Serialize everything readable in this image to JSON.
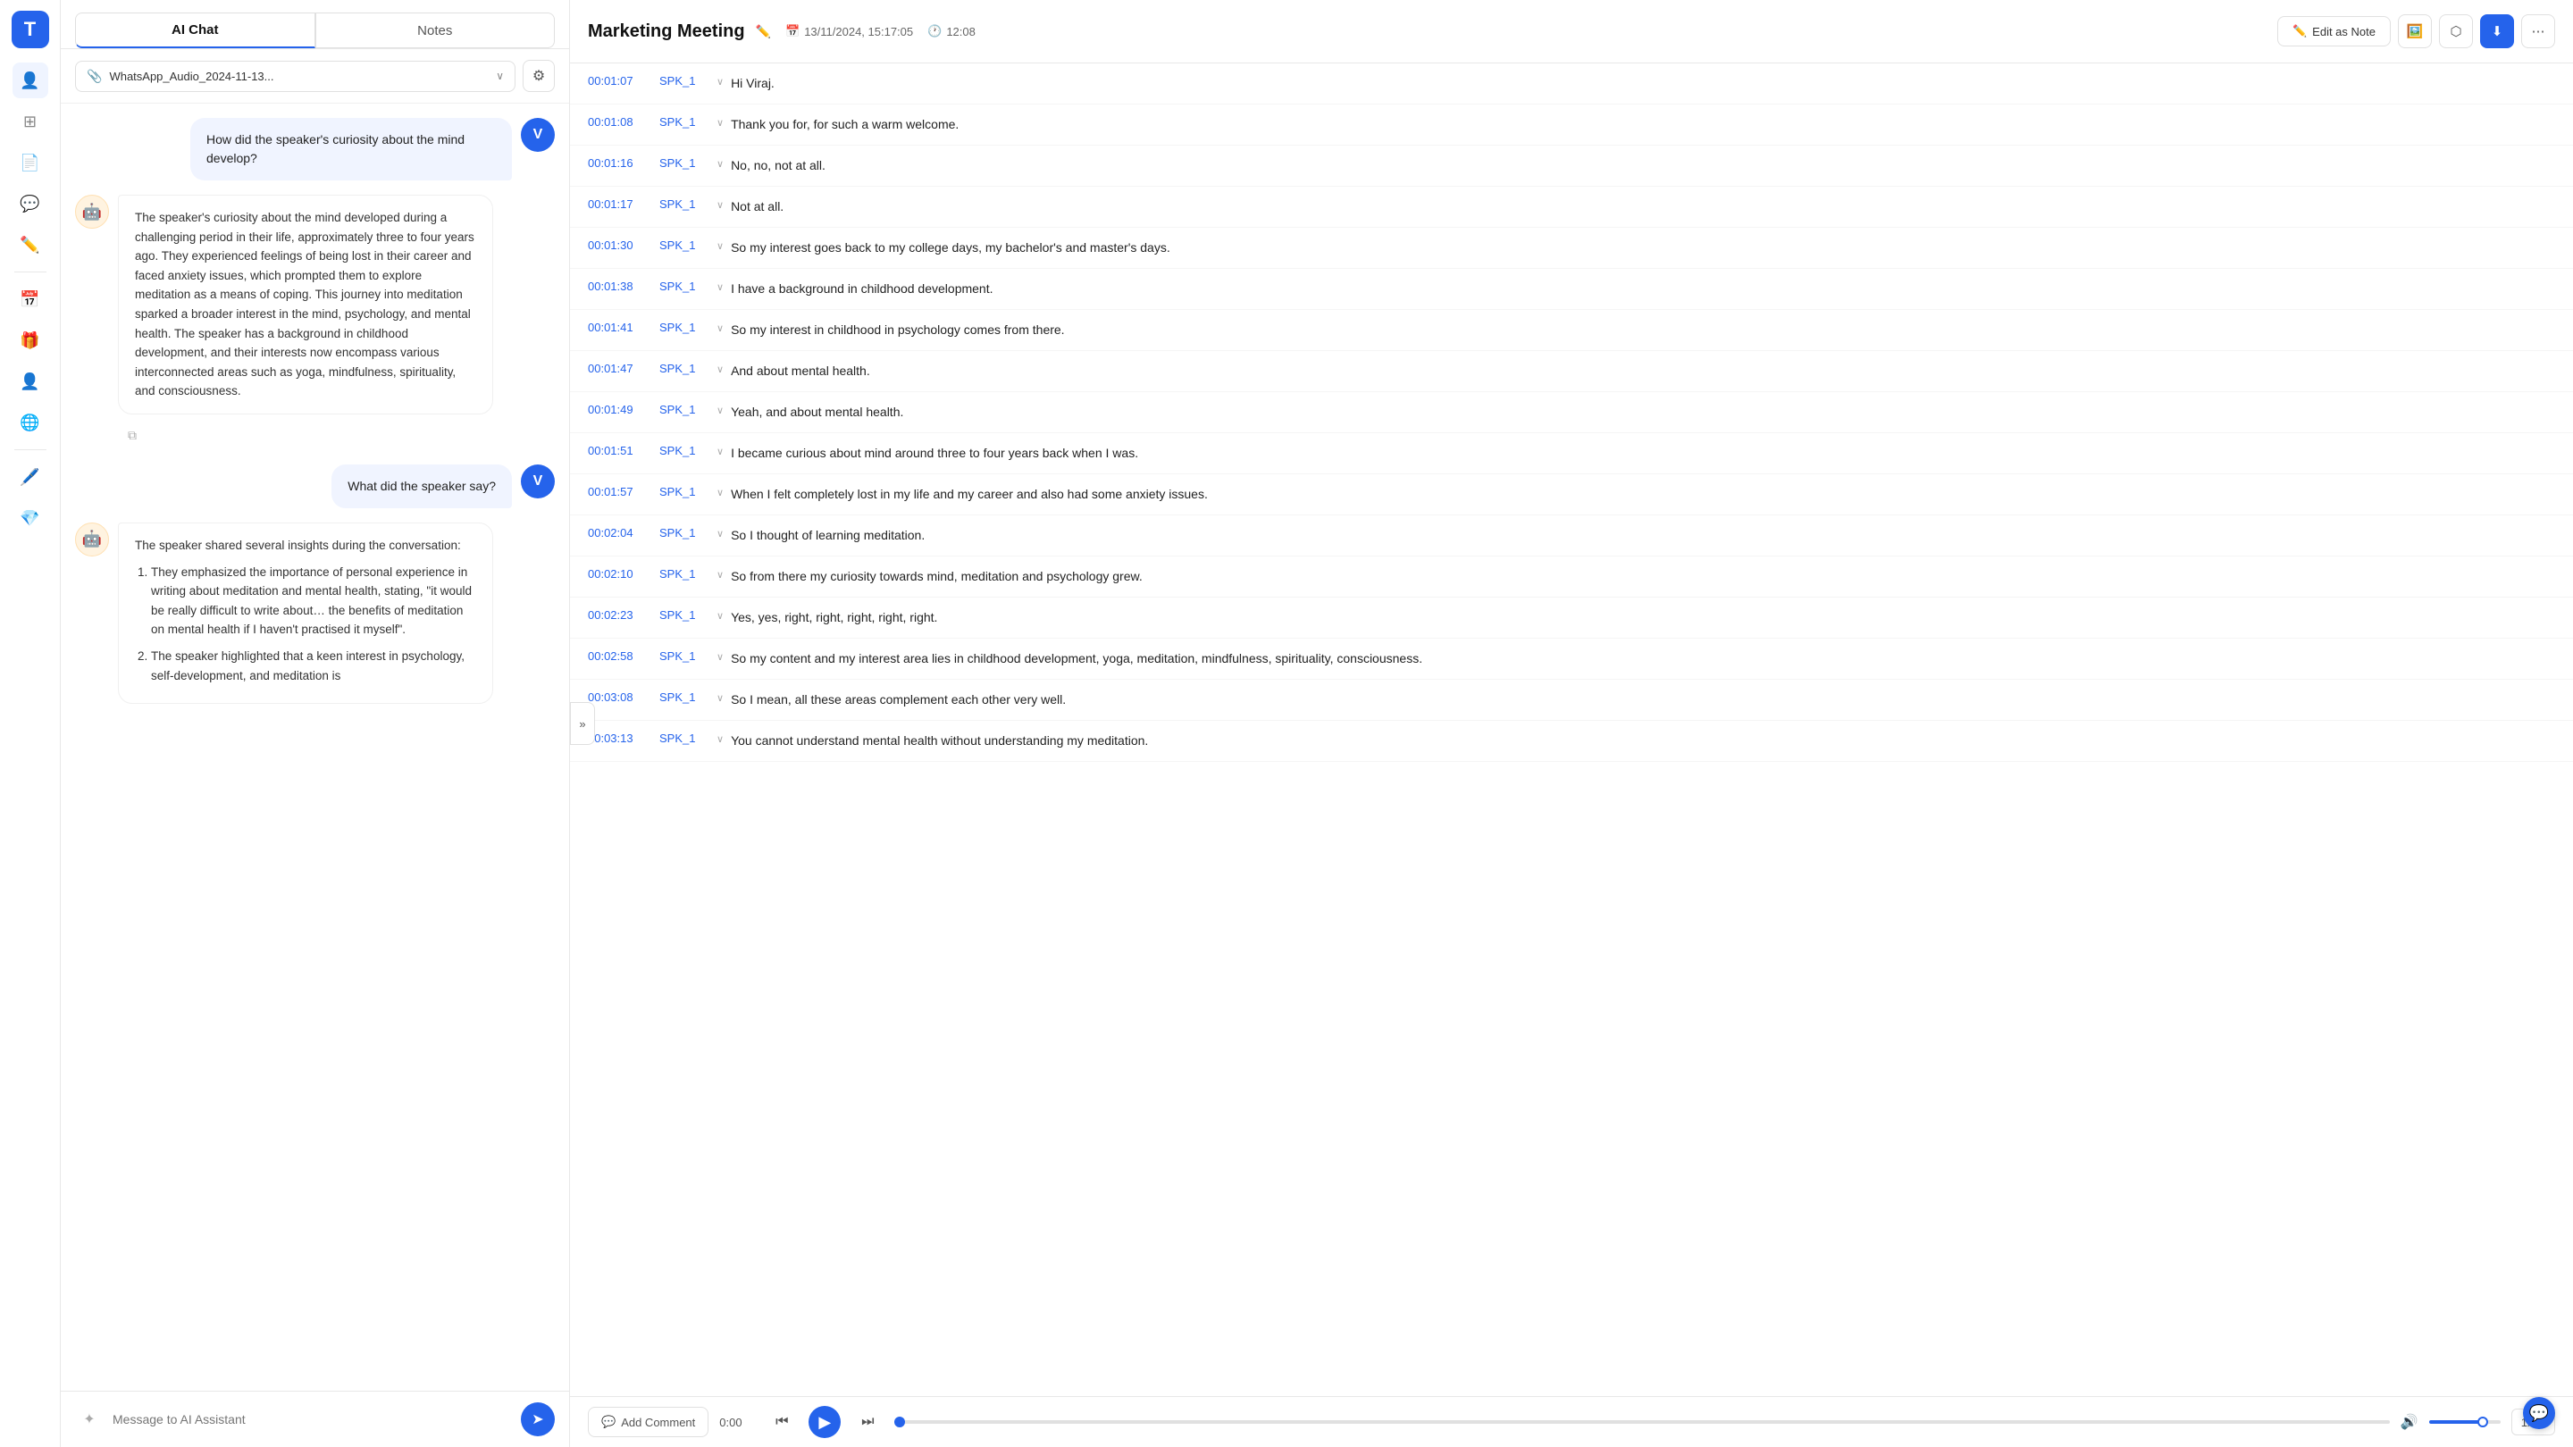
{
  "sidebar": {
    "logo_letter": "T",
    "items": [
      {
        "name": "users",
        "icon": "👤",
        "active": true
      },
      {
        "name": "grid",
        "icon": "⊞",
        "active": false
      },
      {
        "name": "document",
        "icon": "📄",
        "active": false
      },
      {
        "name": "chat",
        "icon": "💬",
        "active": false
      },
      {
        "name": "edit",
        "icon": "✏️",
        "active": false
      },
      {
        "name": "calendar",
        "icon": "📅",
        "active": false
      },
      {
        "name": "gift",
        "icon": "🎁",
        "active": false
      },
      {
        "name": "person",
        "icon": "👤",
        "active": false
      },
      {
        "name": "translate",
        "icon": "🌐",
        "active": false
      },
      {
        "name": "pen",
        "icon": "🖊️",
        "active": false
      },
      {
        "name": "diamond",
        "icon": "💎",
        "active": false
      }
    ]
  },
  "left_panel": {
    "tab_ai_chat": "AI Chat",
    "tab_notes": "Notes",
    "file_name": "WhatsApp_Audio_2024-11-13...",
    "messages": [
      {
        "type": "user",
        "avatar": "V",
        "text": "How did the speaker's curiosity about the mind develop?"
      },
      {
        "type": "ai",
        "text": "The speaker's curiosity about the mind developed during a challenging period in their life, approximately three to four years ago. They experienced feelings of being lost in their career and faced anxiety issues, which prompted them to explore meditation as a means of coping. This journey into meditation sparked a broader interest in the mind, psychology, and mental health. The speaker has a background in childhood development, and their interests now encompass various interconnected areas such as yoga, mindfulness, spirituality, and consciousness."
      },
      {
        "type": "user",
        "avatar": "V",
        "text": "What did the speaker say?"
      },
      {
        "type": "ai",
        "text": "The speaker shared several insights during the conversation:",
        "list": [
          "They emphasized the importance of personal experience in writing about meditation and mental health, stating, \"it would be really difficult to write about… the benefits of meditation on mental health if I haven't practised it myself\".",
          "The speaker highlighted that a keen interest in psychology, self-development, and meditation is..."
        ]
      }
    ],
    "input_placeholder": "Message to AI Assistant"
  },
  "right_panel": {
    "title": "Marketing Meeting",
    "date": "13/11/2024, 15:17:05",
    "duration": "12:08",
    "edit_note_label": "Edit as Note",
    "transcript": [
      {
        "time": "00:01:07",
        "speaker": "SPK_1",
        "text": "Hi Viraj."
      },
      {
        "time": "00:01:08",
        "speaker": "SPK_1",
        "text": "Thank you for, for such a warm welcome."
      },
      {
        "time": "00:01:16",
        "speaker": "SPK_1",
        "text": "No, no, not at all."
      },
      {
        "time": "00:01:17",
        "speaker": "SPK_1",
        "text": "Not at all."
      },
      {
        "time": "00:01:30",
        "speaker": "SPK_1",
        "text": "So my interest goes back to my college days, my bachelor's and master's days."
      },
      {
        "time": "00:01:38",
        "speaker": "SPK_1",
        "text": "I have a background in childhood development."
      },
      {
        "time": "00:01:41",
        "speaker": "SPK_1",
        "text": "So my interest in childhood in psychology comes from there."
      },
      {
        "time": "00:01:47",
        "speaker": "SPK_1",
        "text": "And about mental health."
      },
      {
        "time": "00:01:49",
        "speaker": "SPK_1",
        "text": "Yeah, and about mental health."
      },
      {
        "time": "00:01:51",
        "speaker": "SPK_1",
        "text": "I became curious about mind around three to four years back when I was."
      },
      {
        "time": "00:01:57",
        "speaker": "SPK_1",
        "text": "When I felt completely lost in my life and my career and also had some anxiety issues."
      },
      {
        "time": "00:02:04",
        "speaker": "SPK_1",
        "text": "So I thought of learning meditation."
      },
      {
        "time": "00:02:10",
        "speaker": "SPK_1",
        "text": "So from there my curiosity towards mind, meditation and psychology grew."
      },
      {
        "time": "00:02:23",
        "speaker": "SPK_1",
        "text": "Yes, yes, right, right, right, right, right."
      },
      {
        "time": "00:02:58",
        "speaker": "SPK_1",
        "text": "So my content and my interest area lies in childhood development, yoga, meditation, mindfulness, spirituality, consciousness."
      },
      {
        "time": "00:03:08",
        "speaker": "SPK_1",
        "text": "So I mean, all these areas complement each other very well."
      },
      {
        "time": "00:03:13",
        "speaker": "SPK_1",
        "text": "You cannot understand mental health without understanding my meditation."
      }
    ],
    "player": {
      "add_comment": "Add Comment",
      "time": "0:00",
      "speed": "1x"
    }
  },
  "icons": {
    "pencil": "✏️",
    "calendar": "📅",
    "clock": "🕐",
    "image": "🖼️",
    "share": "⬡",
    "download": "⬇",
    "more": "⋯",
    "chevron_down": "∨",
    "copy": "⧉",
    "send": "➤",
    "sparkle": "✦",
    "attachment": "📎",
    "rewind": "⏮",
    "play": "▶",
    "forward": "⏭",
    "volume": "🔊",
    "comment": "💬",
    "arrow_right": "»"
  }
}
